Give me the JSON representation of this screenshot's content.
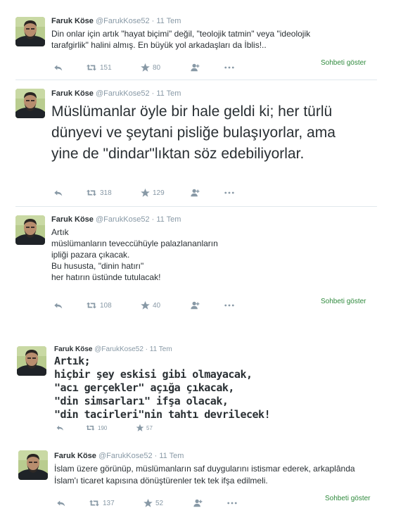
{
  "tweets": [
    {
      "author": "Faruk Köse",
      "handle": "@FarukKose52",
      "separator": "·",
      "date": "11 Tem",
      "text": "Din onlar için artık \"hayat biçimi\" değil, \"teolojik tatmin\" veya \"ideolojik tarafgirlik\" halini almış. En büyük yol arkadaşları da İblis!..",
      "retweets": "151",
      "favorites": "80",
      "show_conversation": "Sohbeti göster"
    },
    {
      "author": "Faruk Köse",
      "handle": "@FarukKose52",
      "separator": "·",
      "date": "11 Tem",
      "text": "Müslümanlar öyle bir hale geldi ki; her türlü dünyevi ve şeytani pisliğe bulaşıyorlar, ama yine de \"dindar\"lıktan söz edebiliyorlar.",
      "retweets": "318",
      "favorites": "129"
    },
    {
      "author": "Faruk Köse",
      "handle": "@FarukKose52",
      "separator": "·",
      "date": "11 Tem",
      "text": "Artık\nmüslümanların teveccühüyle palazlananların\nipliği pazara çıkacak.\nBu hususta, \"dinin hatırı\"\nher hatırın üstünde tutulacak!",
      "retweets": "108",
      "favorites": "40",
      "show_conversation": "Sohbeti göster"
    },
    {
      "author": "Faruk Köse",
      "handle": "@FarukKose52",
      "separator": "·",
      "date": "11 Tem",
      "text": "Artık;\nhiçbir şey eskisi gibi olmayacak,\n\"acı gerçekler\" açığa çıkacak,\n\"din simsarları\" ifşa olacak,\n\"din tacirleri\"nin tahtı devrilecek!",
      "retweets": "190",
      "favorites": "57"
    },
    {
      "author": "Faruk Köse",
      "handle": "@FarukKose52",
      "separator": "·",
      "date": "11 Tem",
      "text": "İslam üzere görünüp, müslümanların saf duygularını istismar ederek, arkaplânda İslam'ı ticaret kapısına dönüştürenler tek tek ifşa edilmeli.",
      "retweets": "137",
      "favorites": "52",
      "show_conversation": "Sohbeti göster"
    }
  ],
  "icons": {
    "reply": "reply-icon",
    "retweet": "retweet-icon",
    "favorite": "star-icon",
    "follow": "add-user-icon",
    "more": "more-icon"
  },
  "colors": {
    "text": "#292f33",
    "muted": "#8899a6",
    "link": "#2f8a3d",
    "divider": "#e1e8ed"
  }
}
